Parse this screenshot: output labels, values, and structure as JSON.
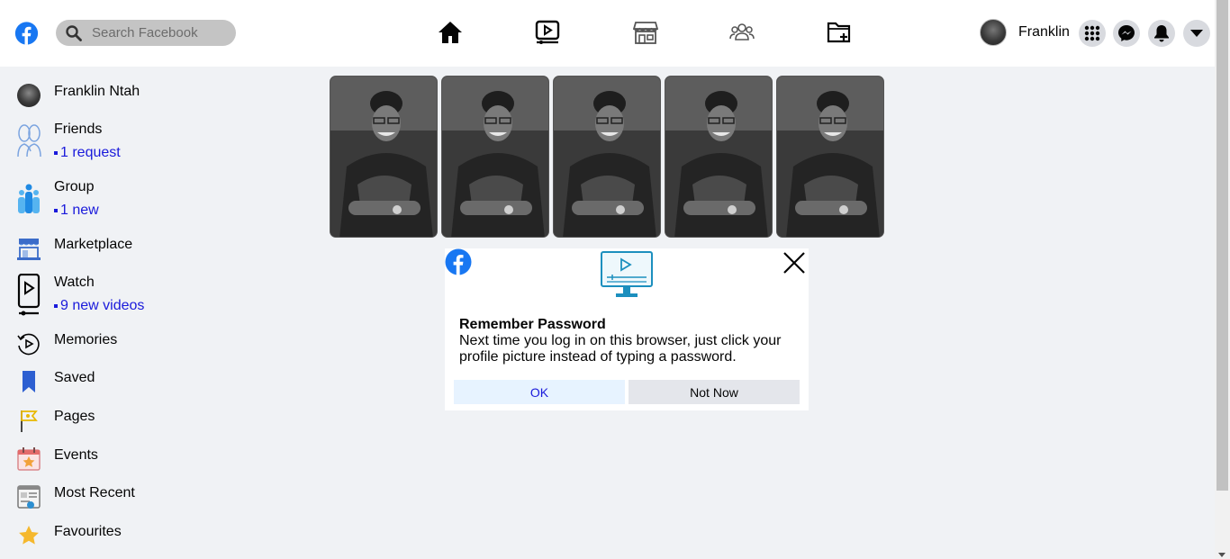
{
  "header": {
    "search_placeholder": "Search Facebook",
    "user_name": "Franklin",
    "brand_color": "#1877f2"
  },
  "sidebar": {
    "items": [
      {
        "label": "Franklin Ntah",
        "icon": "avatar"
      },
      {
        "label": "Friends",
        "icon": "friends-icon",
        "sub": "1 request"
      },
      {
        "label": "Group",
        "icon": "group-icon",
        "sub": "1 new"
      },
      {
        "label": "Marketplace",
        "icon": "marketplace-icon"
      },
      {
        "label": "Watch",
        "icon": "watch-icon",
        "sub": "9 new videos"
      },
      {
        "label": "Memories",
        "icon": "memories-icon"
      },
      {
        "label": "Saved",
        "icon": "bookmark-icon"
      },
      {
        "label": "Pages",
        "icon": "flag-icon"
      },
      {
        "label": "Events",
        "icon": "calendar-icon"
      },
      {
        "label": "Most Recent",
        "icon": "news-feed-icon"
      },
      {
        "label": "Favourites",
        "icon": "star-icon"
      }
    ]
  },
  "stories": {
    "count": 5
  },
  "dialog": {
    "title": "Remember Password",
    "text": "Next time you log in on this browser, just click your profile picture instead of typing a password.",
    "ok_label": "OK",
    "not_now_label": "Not Now"
  }
}
